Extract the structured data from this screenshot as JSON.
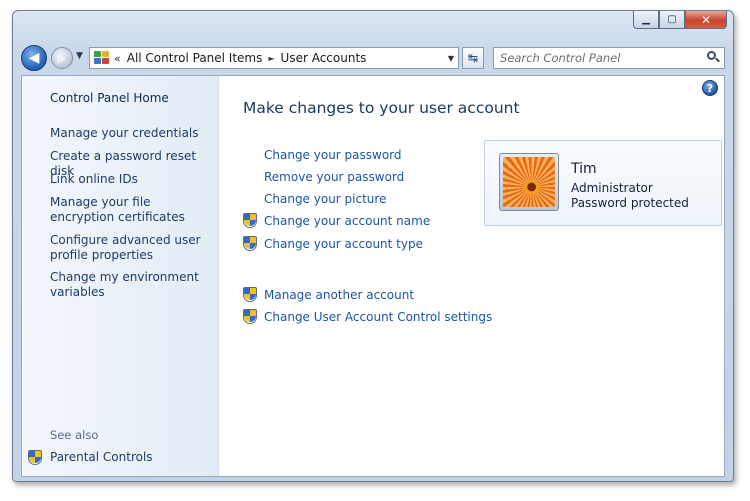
{
  "window": {
    "buttons": {
      "minimize": "▁",
      "maximize": "▢",
      "close": "✕"
    }
  },
  "navbar": {
    "back_icon": "back-arrow-icon",
    "forward_icon": "forward-arrow-icon",
    "breadcrumb_prefix": "«",
    "breadcrumbs": [
      "All Control Panel Items",
      "User Accounts"
    ],
    "crumb_arrow": "►",
    "dropdown_glyph": "▼",
    "refresh_glyph": "↹",
    "search_placeholder": "Search Control Panel"
  },
  "sidebar": {
    "home": "Control Panel Home",
    "links": [
      "Manage your credentials",
      "Create a password reset disk",
      "Link online IDs",
      "Manage your file encryption certificates",
      "Configure advanced user profile properties",
      "Change my environment variables"
    ],
    "see_also_label": "See also",
    "see_also_links": [
      "Parental Controls"
    ]
  },
  "main": {
    "help_glyph": "?",
    "title": "Make changes to your user account",
    "tasks": [
      "Change your password",
      "Remove your password",
      "Change your picture",
      "Change your account name",
      "Change your account type"
    ],
    "more_tasks": [
      "Manage another account",
      "Change User Account Control settings"
    ]
  },
  "user": {
    "name": "Tim",
    "role": "Administrator",
    "status": "Password protected"
  },
  "colors": {
    "link": "#1c56a3",
    "sidebar_text": "#1e3c64",
    "title": "#1b3a63",
    "window_frame": "#c9d8ea",
    "close_button": "#c8452f"
  }
}
